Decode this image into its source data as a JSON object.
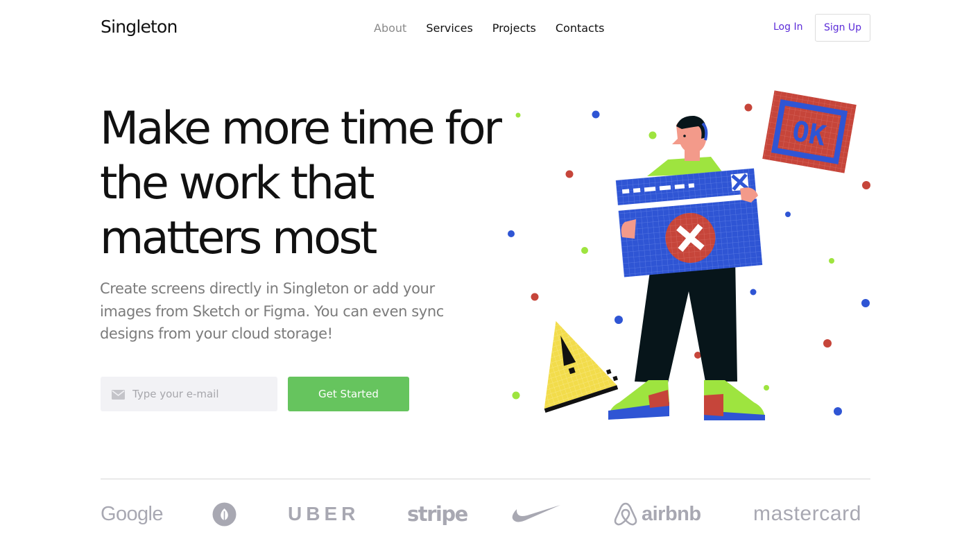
{
  "header": {
    "brand": "Singleton",
    "nav": [
      "About",
      "Services",
      "Projects",
      "Contacts"
    ],
    "login_label": "Log In",
    "signup_label": "Sign Up"
  },
  "hero": {
    "title": "Make more time for the work that matters most",
    "subtitle": "Create screens directly in Singleton or add your images from Sketch or Figma. You can even sync designs from your cloud storage!",
    "email_placeholder": "Type your e-mail",
    "cta_label": "Get Started"
  },
  "illustration": {
    "sign_text": "OK"
  },
  "logos": {
    "google": "Google",
    "uber": "UBER",
    "stripe": "stripe",
    "airbnb": "airbnb",
    "mastercard": "mastercard"
  },
  "colors": {
    "accent": "#5b2bd8",
    "cta": "#66c45e",
    "logo_gray": "#a8a8b2",
    "pixel_blue": "#2f55d4",
    "pixel_red": "#c6453a",
    "shoe_green": "#9ee43f",
    "yellow": "#f2dc4b"
  }
}
